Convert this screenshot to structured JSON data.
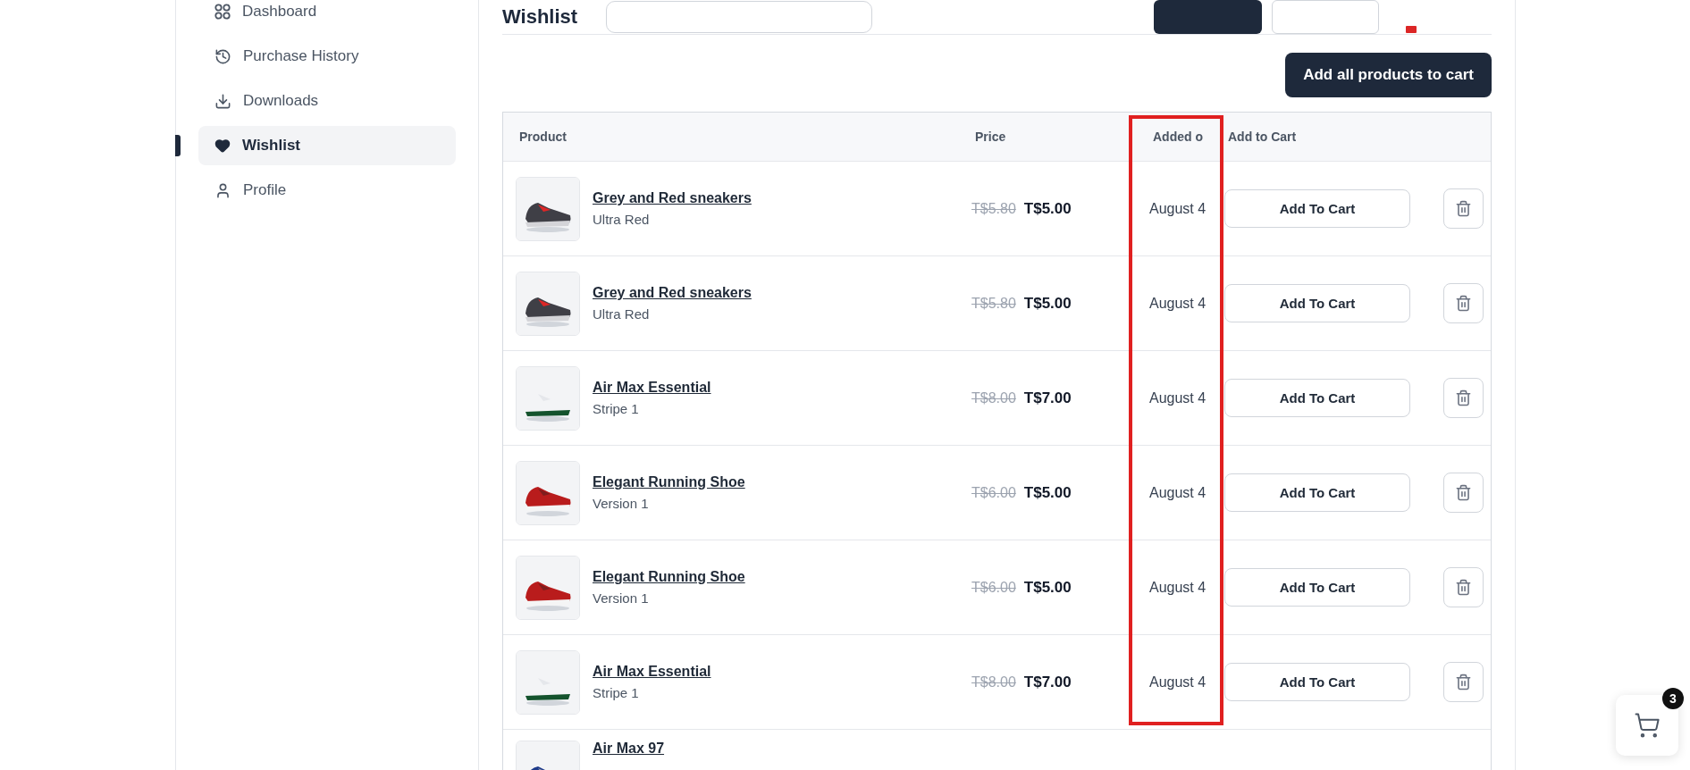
{
  "sidebar": {
    "items": [
      {
        "label": "Dashboard",
        "selected": false
      },
      {
        "label": "Purchase History",
        "selected": false
      },
      {
        "label": "Downloads",
        "selected": false
      },
      {
        "label": "Wishlist",
        "selected": true
      },
      {
        "label": "Profile",
        "selected": false
      }
    ]
  },
  "header": {
    "title": "Wishlist"
  },
  "bulk_button": "Add all products to cart",
  "table": {
    "columns": [
      "Product",
      "Price",
      "Added o",
      "Add to Cart"
    ],
    "rows": [
      {
        "name": "Grey and Red sneakers",
        "variant": "Ultra Red",
        "old_price": "T$5.80",
        "price": "T$5.00",
        "added": "August 4",
        "action": "Add To Cart",
        "hovered": false
      },
      {
        "name": "Grey and Red sneakers",
        "variant": "Ultra Red",
        "old_price": "T$5.80",
        "price": "T$5.00",
        "added": "August 4",
        "action": "Add To Cart",
        "hovered": false
      },
      {
        "name": "Air Max Essential",
        "variant": "Stripe 1",
        "old_price": "T$8.00",
        "price": "T$7.00",
        "added": "August 4",
        "action": "Add To Cart",
        "hovered": false
      },
      {
        "name": "Elegant Running Shoe",
        "variant": "Version 1",
        "old_price": "T$6.00",
        "price": "T$5.00",
        "added": "August 4",
        "action": "Add To Cart",
        "hovered": false
      },
      {
        "name": "Elegant Running Shoe",
        "variant": "Version 1",
        "old_price": "T$6.00",
        "price": "T$5.00",
        "added": "August 4",
        "action": "Add To Cart",
        "hovered": false
      },
      {
        "name": "Air Max Essential",
        "variant": "Stripe 1",
        "old_price": "T$8.00",
        "price": "T$7.00",
        "added": "August 4",
        "action": "Add To Cart",
        "hovered": false
      },
      {
        "name": "Air Max 97",
        "hovered": false
      }
    ]
  },
  "highlight": {
    "kind": "frame"
  },
  "cart": {
    "count": "3"
  }
}
